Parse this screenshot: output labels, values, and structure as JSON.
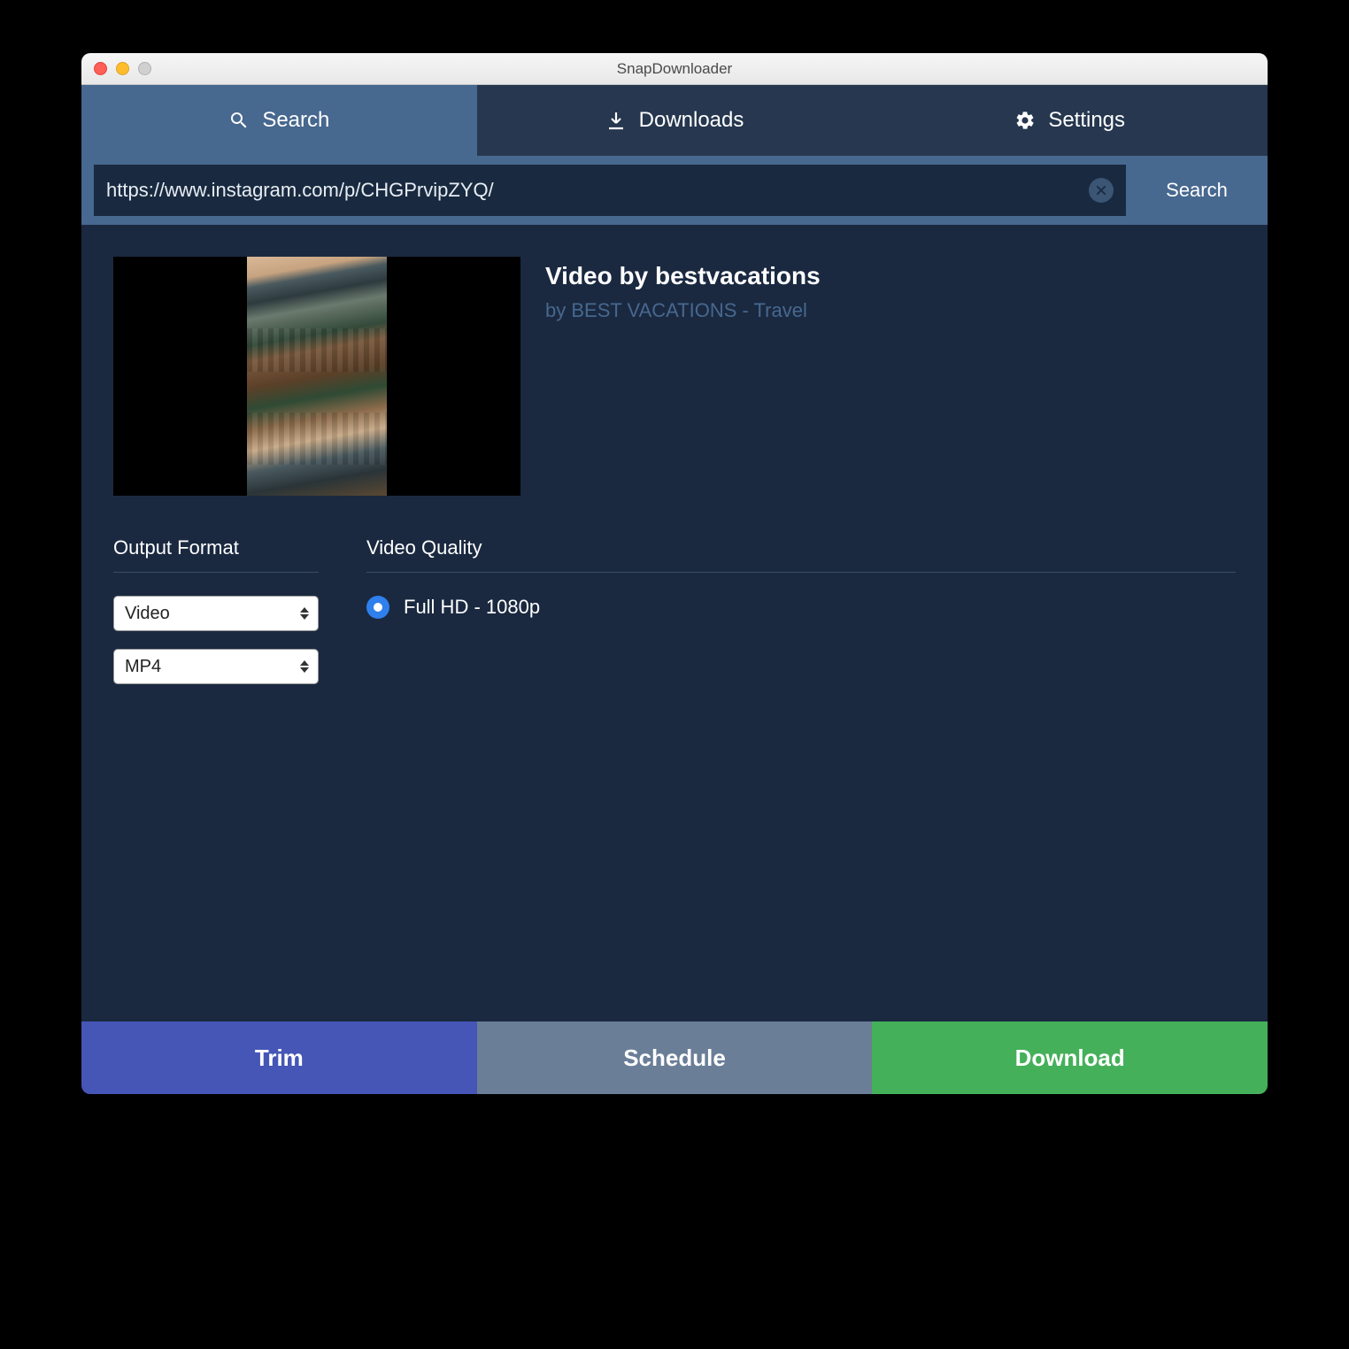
{
  "window": {
    "title": "SnapDownloader"
  },
  "tabs": {
    "search": "Search",
    "downloads": "Downloads",
    "settings": "Settings"
  },
  "searchbar": {
    "value": "https://www.instagram.com/p/CHGPrvipZYQ/",
    "button": "Search"
  },
  "video": {
    "title": "Video by bestvacations",
    "author": "by BEST VACATIONS - Travel"
  },
  "sections": {
    "format": "Output Format",
    "quality": "Video Quality"
  },
  "format": {
    "type": "Video",
    "container": "MP4"
  },
  "quality": {
    "option1": "Full HD - 1080p"
  },
  "footer": {
    "trim": "Trim",
    "schedule": "Schedule",
    "download": "Download"
  }
}
